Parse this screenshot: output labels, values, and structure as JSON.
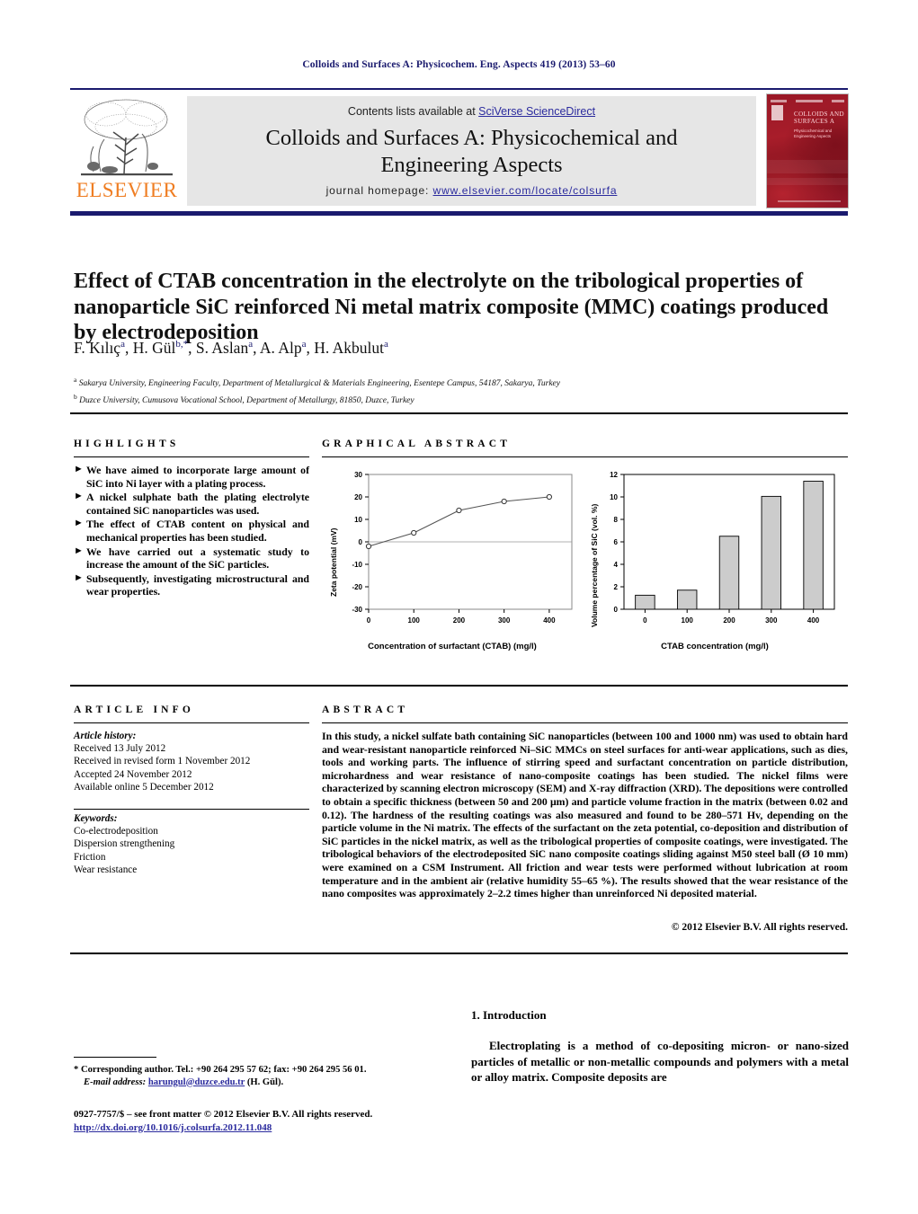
{
  "running_head": "Colloids and Surfaces A: Physicochem. Eng. Aspects 419 (2013) 53–60",
  "header": {
    "contents_prefix": "Contents lists available at ",
    "sciencedirect_link": "SciVerse ScienceDirect",
    "journal_title_line1": "Colloids and Surfaces A: Physicochemical and",
    "journal_title_line2": "Engineering Aspects",
    "homepage_prefix": "journal homepage: ",
    "homepage_url": "www.elsevier.com/locate/colsurfa",
    "elsevier_wordmark": "ELSEVIER",
    "cover_title": "COLLOIDS AND SURFACES A",
    "cover_subtitle": "Physicochemical and Engineering Aspects"
  },
  "article": {
    "title": "Effect of CTAB concentration in the electrolyte on the tribological properties of nanoparticle SiC reinforced Ni metal matrix composite (MMC) coatings produced by electrodeposition",
    "authors_html": "F. Kılıç<sup>a</sup>, H. Gül<sup>b,*</sup>, S. Aslan<sup>a</sup>, A. Alp<sup>a</sup>, H. Akbulut<sup>a</sup>",
    "affiliation_a": "Sakarya University, Engineering Faculty, Department of Metallurgical & Materials Engineering, Esentepe Campus, 54187, Sakarya, Turkey",
    "affiliation_b": "Duzce University, Cumusova Vocational School, Department of Metallurgy, 81850, Duzce, Turkey"
  },
  "sections": {
    "highlights_heading": "HIGHLIGHTS",
    "graphical_abstract_heading": "GRAPHICAL ABSTRACT",
    "article_info_heading": "ARTICLE INFO",
    "abstract_heading": "ABSTRACT"
  },
  "highlights": [
    "We have aimed to incorporate large amount of SiC into Ni layer with a plating process.",
    "A nickel sulphate bath the plating electrolyte contained SiC nanoparticles was used.",
    "The effect of CTAB content on physical and mechanical properties has been studied.",
    "We have carried out a systematic study to increase the amount of the SiC particles.",
    "Subsequently, investigating microstructural and wear properties."
  ],
  "article_info": {
    "history_label": "Article history:",
    "history": [
      "Received 13 July 2012",
      "Received in revised form 1 November 2012",
      "Accepted 24 November 2012",
      "Available online 5 December 2012"
    ],
    "keywords_label": "Keywords:",
    "keywords": [
      "Co-electrodeposition",
      "Dispersion strengthening",
      "Friction",
      "Wear resistance"
    ]
  },
  "abstract": {
    "text": "In this study, a nickel sulfate bath containing SiC nanoparticles (between 100 and 1000 nm) was used to obtain hard and wear-resistant nanoparticle reinforced Ni–SiC MMCs on steel surfaces for anti-wear applications, such as dies, tools and working parts. The influence of stirring speed and surfactant concentration on particle distribution, microhardness and wear resistance of nano-composite coatings has been studied. The nickel films were characterized by scanning electron microscopy (SEM) and X-ray diffraction (XRD). The depositions were controlled to obtain a specific thickness (between 50 and 200 μm) and particle volume fraction in the matrix (between 0.02 and 0.12). The hardness of the resulting coatings was also measured and found to be 280–571 Hv, depending on the particle volume in the Ni matrix. The effects of the surfactant on the zeta potential, co-deposition and distribution of SiC particles in the nickel matrix, as well as the tribological properties of composite coatings, were investigated. The tribological behaviors of the electrodeposited SiC nano composite coatings sliding against M50 steel ball (Ø 10 mm) were examined on a CSM Instrument. All friction and wear tests were performed without lubrication at room temperature and in the ambient air (relative humidity 55–65 %). The results showed that the wear resistance of the nano composites was approximately 2–2.2 times higher than unreinforced Ni deposited material.",
    "copyright": "© 2012 Elsevier B.V. All rights reserved."
  },
  "introduction": {
    "heading": "1.  Introduction",
    "paragraph": "Electroplating is a method of co-depositing micron- or nano-sized particles of metallic or non-metallic compounds and polymers with a metal or alloy matrix. Composite deposits are"
  },
  "footnotes": {
    "corresponding_line1": "* Corresponding author. Tel.: +90 264 295 57 62; fax: +90 264 295 56 01.",
    "email_label": "E-mail address:",
    "email": "harungul@duzce.edu.tr",
    "email_suffix": "(H. Gül).",
    "issn_line": "0927-7757/$ – see front matter © 2012 Elsevier B.V. All rights reserved.",
    "doi": "http://dx.doi.org/10.1016/j.colsurfa.2012.11.048"
  },
  "chart_data": [
    {
      "type": "line",
      "title": "",
      "xlabel": "Concentration of surfactant (CTAB) (mg/l)",
      "ylabel": "Zeta potential (mV)",
      "x": [
        0,
        100,
        200,
        300,
        400
      ],
      "values": [
        -2,
        4,
        14,
        18,
        20
      ],
      "xlim": [
        0,
        450
      ],
      "ylim": [
        -30,
        30
      ],
      "xticks": [
        0,
        100,
        200,
        300,
        400
      ],
      "yticks": [
        -30,
        -20,
        -10,
        0,
        10,
        20,
        30
      ],
      "grid": false,
      "legend": "none",
      "marker": "open-circle",
      "line_color": "#555555",
      "zero_line": true
    },
    {
      "type": "bar",
      "title": "",
      "xlabel": "CTAB concentration (mg/l)",
      "ylabel": "Volume percentage of SiC (vol. %)",
      "categories": [
        "0",
        "100",
        "200",
        "300",
        "400"
      ],
      "values": [
        1.25,
        1.7,
        6.5,
        10.05,
        11.4
      ],
      "ylim": [
        0,
        12
      ],
      "yticks": [
        0,
        2,
        4,
        6,
        8,
        10,
        12
      ],
      "grid": false,
      "legend": "none",
      "bar_color": "#cccccc",
      "bar_edge_color": "#000000"
    }
  ]
}
